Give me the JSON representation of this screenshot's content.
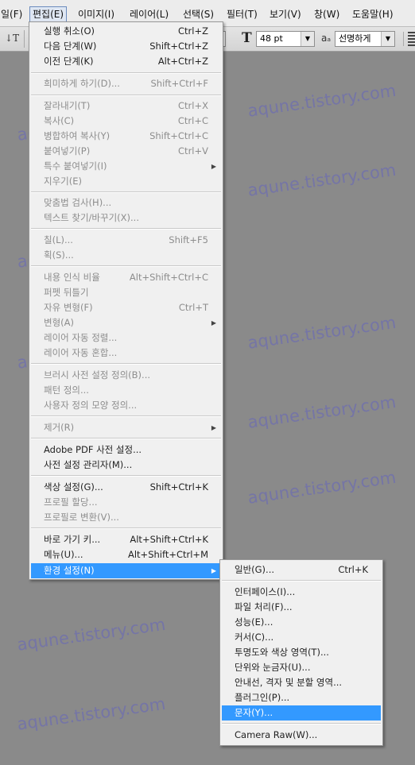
{
  "menubar": {
    "items": [
      {
        "label": "일(F)"
      },
      {
        "label": "편집(E)"
      },
      {
        "label": "이미지(I)"
      },
      {
        "label": "레이어(L)"
      },
      {
        "label": "선택(S)"
      },
      {
        "label": "필터(T)"
      },
      {
        "label": "보기(V)"
      },
      {
        "label": "창(W)"
      },
      {
        "label": "도움말(H)"
      }
    ]
  },
  "options": {
    "font_size": "48 pt",
    "antialias_label": "aₐ",
    "antialias": "선명하게",
    "text_tool_glyph": "T",
    "orient_glyph": "↓T"
  },
  "watermark": "aqune.tistory.com",
  "edit_menu": {
    "items": [
      {
        "label": "실행 취소(O)",
        "shortcut": "Ctrl+Z",
        "enabled": true
      },
      {
        "label": "다음 단계(W)",
        "shortcut": "Shift+Ctrl+Z",
        "enabled": true
      },
      {
        "label": "이전 단계(K)",
        "shortcut": "Alt+Ctrl+Z",
        "enabled": true
      },
      {
        "label": "희미하게 하기(D)...",
        "shortcut": "Shift+Ctrl+F",
        "enabled": false
      },
      {
        "label": "잘라내기(T)",
        "shortcut": "Ctrl+X",
        "enabled": false
      },
      {
        "label": "복사(C)",
        "shortcut": "Ctrl+C",
        "enabled": false
      },
      {
        "label": "병합하여 복사(Y)",
        "shortcut": "Shift+Ctrl+C",
        "enabled": false
      },
      {
        "label": "붙여넣기(P)",
        "shortcut": "Ctrl+V",
        "enabled": false
      },
      {
        "label": "특수 붙여넣기(I)",
        "shortcut": "",
        "enabled": false,
        "submenu": true
      },
      {
        "label": "지우기(E)",
        "shortcut": "",
        "enabled": false
      },
      {
        "label": "맞춤법 검사(H)...",
        "shortcut": "",
        "enabled": false
      },
      {
        "label": "텍스트 찾기/바꾸기(X)...",
        "shortcut": "",
        "enabled": false
      },
      {
        "label": "칠(L)...",
        "shortcut": "Shift+F5",
        "enabled": false
      },
      {
        "label": "획(S)...",
        "shortcut": "",
        "enabled": false
      },
      {
        "label": "내용 인식 비율",
        "shortcut": "Alt+Shift+Ctrl+C",
        "enabled": false
      },
      {
        "label": "퍼펫 뒤틀기",
        "shortcut": "",
        "enabled": false
      },
      {
        "label": "자유 변형(F)",
        "shortcut": "Ctrl+T",
        "enabled": false
      },
      {
        "label": "변형(A)",
        "shortcut": "",
        "enabled": false,
        "submenu": true
      },
      {
        "label": "레이어 자동 정렬...",
        "shortcut": "",
        "enabled": false
      },
      {
        "label": "레이어 자동 혼합...",
        "shortcut": "",
        "enabled": false
      },
      {
        "label": "브러시 사전 설정 정의(B)...",
        "shortcut": "",
        "enabled": false
      },
      {
        "label": "패턴 정의...",
        "shortcut": "",
        "enabled": false
      },
      {
        "label": "사용자 정의 모양 정의...",
        "shortcut": "",
        "enabled": false
      },
      {
        "label": "제거(R)",
        "shortcut": "",
        "enabled": false,
        "submenu": true
      },
      {
        "label": "Adobe PDF 사전 설정...",
        "shortcut": "",
        "enabled": true
      },
      {
        "label": "사전 설정 관리자(M)...",
        "shortcut": "",
        "enabled": true
      },
      {
        "label": "색상 설정(G)...",
        "shortcut": "Shift+Ctrl+K",
        "enabled": true
      },
      {
        "label": "프로필 할당...",
        "shortcut": "",
        "enabled": false
      },
      {
        "label": "프로필로 변환(V)...",
        "shortcut": "",
        "enabled": false
      },
      {
        "label": "바로 가기 키...",
        "shortcut": "Alt+Shift+Ctrl+K",
        "enabled": true
      },
      {
        "label": "메뉴(U)...",
        "shortcut": "Alt+Shift+Ctrl+M",
        "enabled": true
      },
      {
        "label": "환경 설정(N)",
        "shortcut": "",
        "enabled": true,
        "submenu": true,
        "highlighted": true
      }
    ]
  },
  "prefs_menu": {
    "items": [
      {
        "label": "일반(G)...",
        "shortcut": "Ctrl+K"
      },
      {
        "label": "인터페이스(I)..."
      },
      {
        "label": "파일 처리(F)..."
      },
      {
        "label": "성능(E)..."
      },
      {
        "label": "커서(C)..."
      },
      {
        "label": "투명도와 색상 영역(T)..."
      },
      {
        "label": "단위와 눈금자(U)..."
      },
      {
        "label": "안내선, 격자 및 분할 영역..."
      },
      {
        "label": "플러그인(P)..."
      },
      {
        "label": "문자(Y)...",
        "highlighted": true
      },
      {
        "label": "Camera Raw(W)..."
      }
    ]
  }
}
